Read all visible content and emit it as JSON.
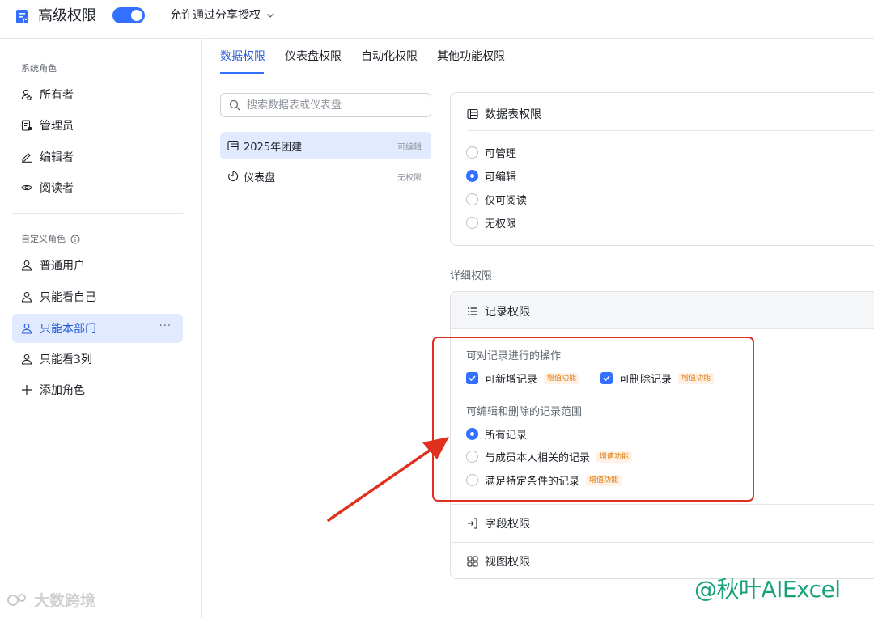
{
  "header": {
    "title": "高级权限",
    "toggle_on": true,
    "share_option": "允许通过分享授权"
  },
  "sidebar": {
    "system_section": "系统角色",
    "system_roles": [
      {
        "label": "所有者",
        "icon": "owner-icon"
      },
      {
        "label": "管理员",
        "icon": "admin-icon"
      },
      {
        "label": "编辑者",
        "icon": "pencil-icon"
      },
      {
        "label": "阅读者",
        "icon": "eye-icon"
      }
    ],
    "custom_section": "自定义角色",
    "custom_roles": [
      {
        "label": "普通用户",
        "icon": "user-icon"
      },
      {
        "label": "只能看自己",
        "icon": "user-icon"
      },
      {
        "label": "只能本部门",
        "icon": "user-icon",
        "active": true,
        "more": "···"
      },
      {
        "label": "只能看3列",
        "icon": "user-icon"
      }
    ],
    "add_role": "添加角色"
  },
  "tabs": [
    {
      "label": "数据权限",
      "active": true
    },
    {
      "label": "仪表盘权限"
    },
    {
      "label": "自动化权限"
    },
    {
      "label": "其他功能权限"
    }
  ],
  "search": {
    "placeholder": "搜索数据表或仪表盘"
  },
  "tables": [
    {
      "name": "2025年团建",
      "permission": "可编辑",
      "active": true,
      "icon": "table-icon"
    },
    {
      "name": "仪表盘",
      "permission": "无权限",
      "icon": "dashboard-icon"
    }
  ],
  "table_permission": {
    "title": "数据表权限",
    "options": [
      {
        "label": "可管理",
        "selected": false
      },
      {
        "label": "可编辑",
        "selected": true
      },
      {
        "label": "仅可阅读",
        "selected": false
      },
      {
        "label": "无权限",
        "selected": false
      }
    ]
  },
  "detail": {
    "label": "详细权限",
    "record": {
      "title": "记录权限",
      "ops_label": "可对记录进行的操作",
      "ops": [
        {
          "label": "可新增记录",
          "checked": true,
          "badge": "增值功能"
        },
        {
          "label": "可删除记录",
          "checked": true,
          "badge": "增值功能"
        }
      ],
      "scope_label": "可编辑和删除的记录范围",
      "scopes": [
        {
          "label": "所有记录",
          "selected": true,
          "badge": ""
        },
        {
          "label": "与成员本人相关的记录",
          "selected": false,
          "badge": "增值功能"
        },
        {
          "label": "满足特定条件的记录",
          "selected": false,
          "badge": "增值功能"
        }
      ]
    },
    "field_title": "字段权限",
    "view_title": "视图权限"
  },
  "watermarks": {
    "left": "大数跨境",
    "right": "@秋叶AIExcel"
  },
  "colors": {
    "accent": "#3370ff",
    "highlight": "#e0301e",
    "badge_text": "#de7802"
  }
}
